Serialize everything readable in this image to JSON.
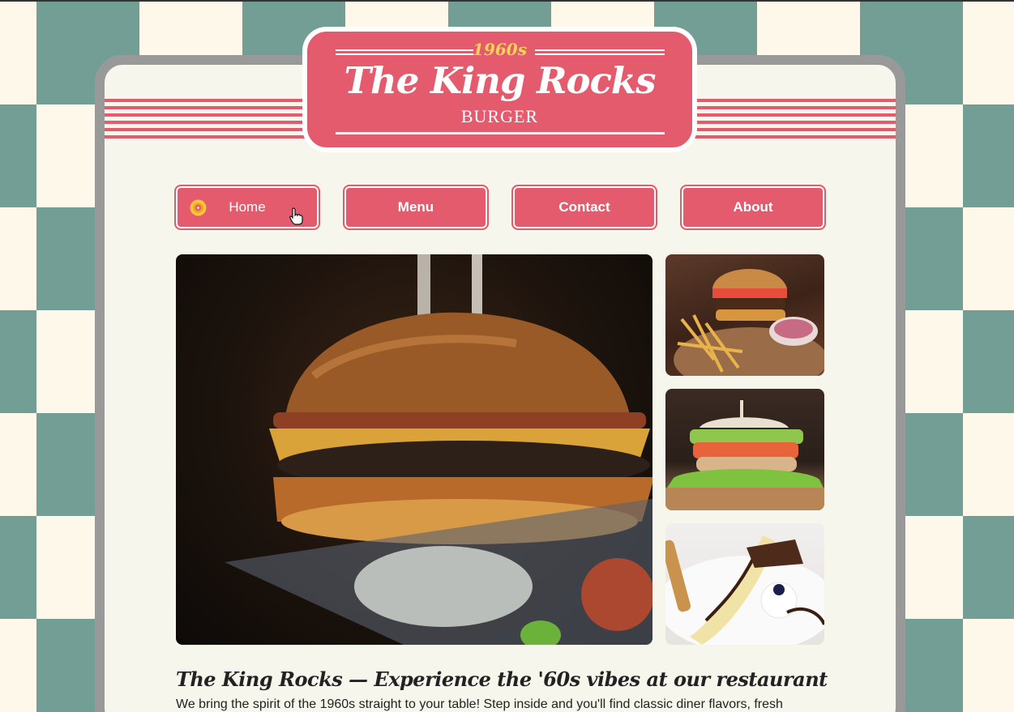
{
  "header": {
    "year": "1960s",
    "title": "The King Rocks",
    "subtitle": "BURGER"
  },
  "nav": {
    "items": [
      {
        "label": "Home",
        "active": true
      },
      {
        "label": "Menu"
      },
      {
        "label": "Contact"
      },
      {
        "label": "About"
      }
    ]
  },
  "gallery": {
    "main": "burger-photo",
    "side": [
      "burger-fries-photo",
      "sandwich-photo",
      "banana-dessert-photo"
    ]
  },
  "content": {
    "headline": "The King Rocks — Experience the '60s vibes at our restaurant",
    "intro": "We bring the spirit of the 1960s straight to your table! Step inside and you'll find classic diner flavors, fresh"
  },
  "colors": {
    "accent": "#e35b6c",
    "checker": "#739e95",
    "cream": "#fdf8e9",
    "frame": "#999999",
    "gold": "#f7d35a"
  }
}
